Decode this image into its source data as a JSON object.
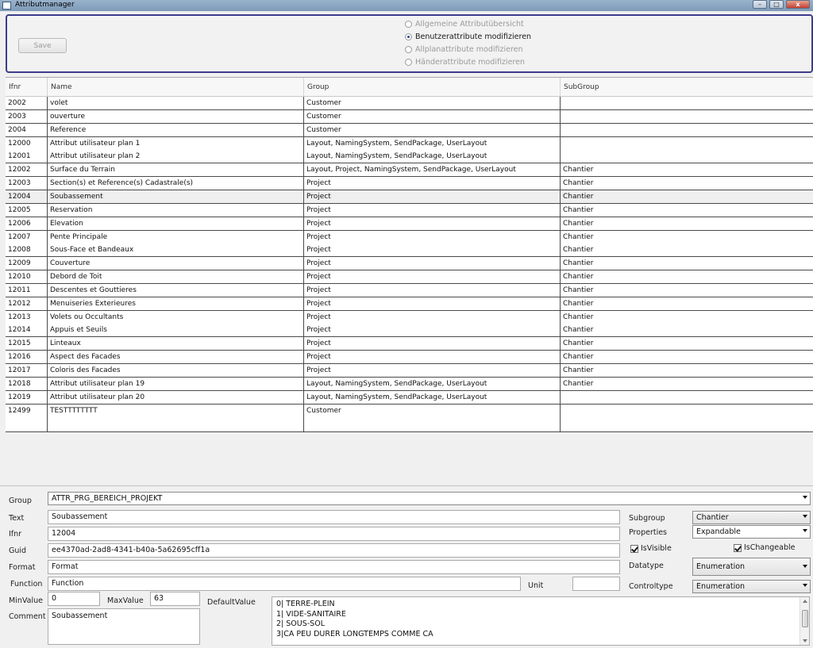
{
  "window": {
    "title": "Attributmanager",
    "minimize": "–",
    "maximize": "□",
    "close": "x"
  },
  "toolbar": {
    "save_label": "Save"
  },
  "mode_options": [
    {
      "label": "Allgemeine Attributübersicht",
      "selected": false,
      "enabled": false
    },
    {
      "label": "Benutzerattribute modifizieren",
      "selected": true,
      "enabled": true
    },
    {
      "label": "Allplanattribute modifizieren",
      "selected": false,
      "enabled": false
    },
    {
      "label": "Händerattribute modifizieren",
      "selected": false,
      "enabled": false
    }
  ],
  "grid": {
    "headers": [
      "Ifnr",
      "Name",
      "Group",
      "SubGroup"
    ],
    "rows": [
      [
        "2002",
        "volet",
        "Customer",
        ""
      ],
      [
        "2003",
        "ouverture",
        "Customer",
        ""
      ],
      [
        "2004",
        "Reference",
        "Customer",
        ""
      ],
      [
        "12000",
        "Attribut utilisateur plan 1",
        "Layout, NamingSystem, SendPackage, UserLayout",
        ""
      ],
      [
        "12001",
        "Attribut utilisateur plan 2",
        "Layout, NamingSystem, SendPackage, UserLayout",
        ""
      ],
      [
        "12002",
        "Surface du Terrain",
        "Layout, Project, NamingSystem, SendPackage, UserLayout",
        "Chantier"
      ],
      [
        "12003",
        "Section(s) et Reference(s) Cadastrale(s)",
        "Project",
        "Chantier"
      ],
      [
        "12004",
        "Soubassement",
        "Project",
        "Chantier"
      ],
      [
        "12005",
        "Reservation",
        "Project",
        "Chantier"
      ],
      [
        "12006",
        "Elevation",
        "Project",
        "Chantier"
      ],
      [
        "12007",
        "Pente Principale",
        "Project",
        "Chantier"
      ],
      [
        "12008",
        "Sous-Face et Bandeaux",
        "Project",
        "Chantier"
      ],
      [
        "12009",
        "Couverture",
        "Project",
        "Chantier"
      ],
      [
        "12010",
        "Debord de Toit",
        "Project",
        "Chantier"
      ],
      [
        "12011",
        "Descentes et Gouttieres",
        "Project",
        "Chantier"
      ],
      [
        "12012",
        "Menuiseries Exterieures",
        "Project",
        "Chantier"
      ],
      [
        "12013",
        "Volets ou Occultants",
        "Project",
        "Chantier"
      ],
      [
        "12014",
        "Appuis et Seuils",
        "Project",
        "Chantier"
      ],
      [
        "12015",
        "Linteaux",
        "Project",
        "Chantier"
      ],
      [
        "12016",
        "Aspect des Facades",
        "Project",
        "Chantier"
      ],
      [
        "12017",
        "Coloris des Facades",
        "Project",
        "Chantier"
      ],
      [
        "12018",
        "Attribut utilisateur plan 19",
        "Layout, NamingSystem, SendPackage, UserLayout",
        "Chantier"
      ],
      [
        "12019",
        "Attribut utilisateur plan 20",
        "Layout, NamingSystem, SendPackage, UserLayout",
        ""
      ],
      [
        "12499",
        "TESTTTTTTTT",
        "Customer",
        ""
      ]
    ],
    "selected_row": 7
  },
  "form": {
    "group_label": "Group",
    "group_value": "ATTR_PRG_BEREICH_PROJEKT",
    "text_label": "Text",
    "text_value": "Soubassement",
    "ifnr_label": "Ifnr",
    "ifnr_value": "12004",
    "guid_label": "Guid",
    "guid_value": "ee4370ad-2ad8-4341-b40a-5a62695cff1a",
    "format_label": "Format",
    "format_value": "Format",
    "function_label": "Function",
    "function_value": "Function",
    "unit_label": "Unit",
    "unit_value": "",
    "minvalue_label": "MinValue",
    "minvalue_value": "0",
    "maxvalue_label": "MaxValue",
    "maxvalue_value": "63",
    "defaultvalue_label": "DefaultValue",
    "comment_label": "Comment",
    "comment_value": "Soubassement",
    "subgroup_label": "Subgroup",
    "subgroup_value": "Chantier",
    "properties_label": "Properties",
    "properties_value": "Expandable",
    "isvisible_label": "IsVisible",
    "ischangeable_label": "IsChangeable",
    "datatype_label": "Datatype",
    "datatype_value": "Enumeration",
    "controltype_label": "Controltype",
    "controltype_value": "Enumeration",
    "default_list": [
      "0| TERRE-PLEIN",
      "1| VIDE-SANITAIRE",
      "2| SOUS-SOL",
      "3|CA PEU DURER LONGTEMPS COMME CA"
    ]
  }
}
